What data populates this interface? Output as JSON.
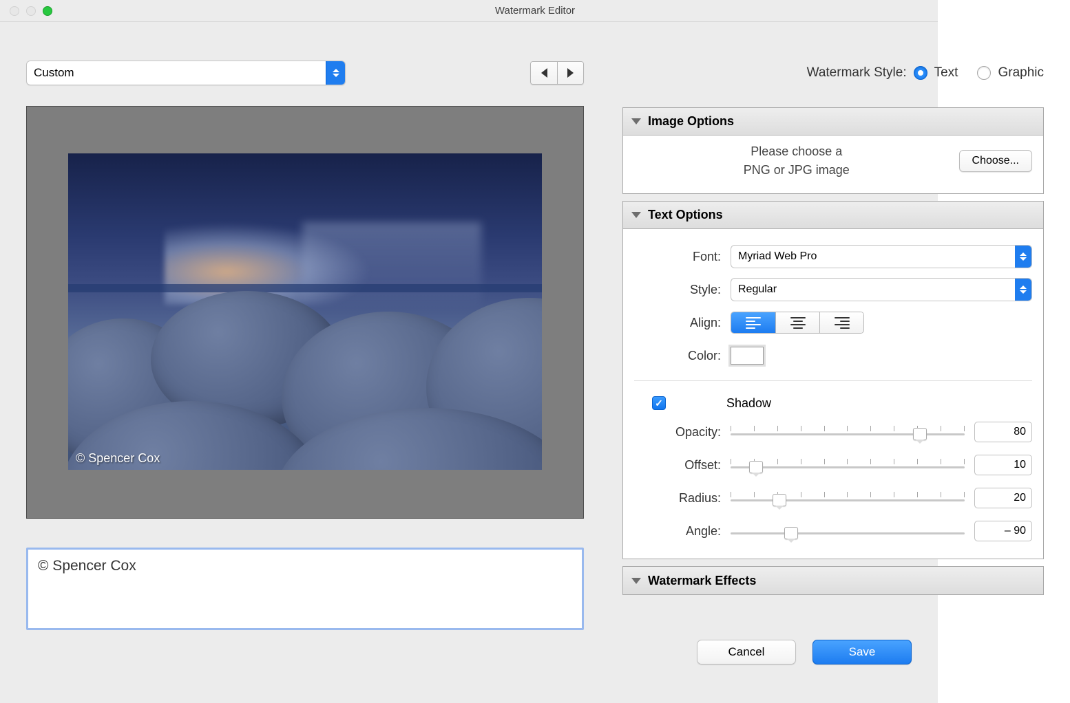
{
  "window": {
    "title": "Watermark Editor"
  },
  "preset": {
    "value": "Custom"
  },
  "watermark_text": "© Spencer Cox",
  "styleLine": {
    "label": "Watermark Style:",
    "text_label": "Text",
    "graphic_label": "Graphic",
    "selected": "Text"
  },
  "panels": {
    "image": {
      "title": "Image Options",
      "msg1": "Please choose a",
      "msg2": "PNG or JPG image",
      "choose": "Choose..."
    },
    "text": {
      "title": "Text Options",
      "font_label": "Font:",
      "font_value": "Myriad Web Pro",
      "style_label": "Style:",
      "style_value": "Regular",
      "align_label": "Align:",
      "color_label": "Color:",
      "shadow_label": "Shadow",
      "opacity_label": "Opacity:",
      "opacity_value": "80",
      "offset_label": "Offset:",
      "offset_value": "10",
      "radius_label": "Radius:",
      "radius_value": "20",
      "angle_label": "Angle:",
      "angle_value": "– 90"
    },
    "effects": {
      "title": "Watermark Effects"
    }
  },
  "footer": {
    "cancel": "Cancel",
    "save": "Save"
  }
}
